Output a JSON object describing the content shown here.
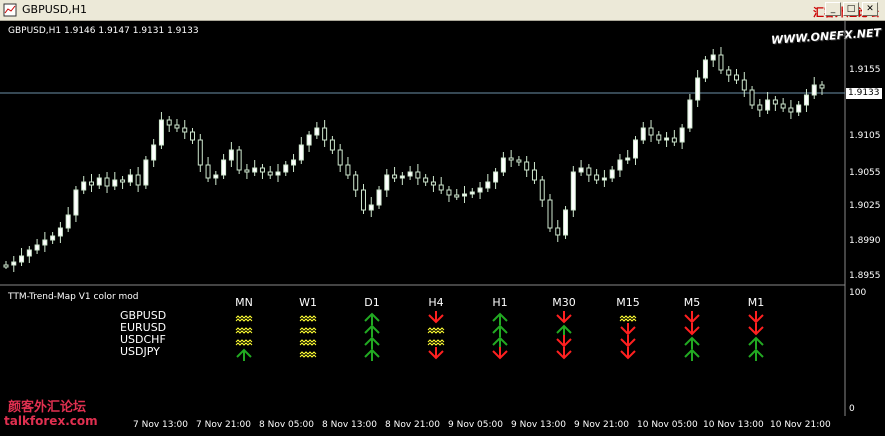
{
  "window": {
    "title": "GBPUSD,H1",
    "buttons": {
      "minimize": "_",
      "restore": "□",
      "close": "✕"
    }
  },
  "watermarks": {
    "top_cn": "汇客外汇论坛",
    "top_url": "WWW.ONEFX.NET",
    "bottom_cn": "颜客外汇论坛",
    "bottom_url": "talkforex.com"
  },
  "chart": {
    "symbol_header": "GBPUSD,H1  1.9146 1.9147 1.9131 1.9133",
    "current_price": "1.9133",
    "y_labels": [
      "1.9155",
      "1.9105",
      "1.9055",
      "1.9025",
      "1.8990",
      "1.8955"
    ],
    "x_labels": [
      "7 Nov 13:00",
      "7 Nov 21:00",
      "8 Nov 05:00",
      "8 Nov 13:00",
      "8 Nov 21:00",
      "9 Nov 05:00",
      "9 Nov 13:00",
      "9 Nov 21:00",
      "10 Nov 05:00",
      "10 Nov 13:00",
      "10 Nov 21:00"
    ]
  },
  "indicator": {
    "title": "TTM-Trend-Map V1 color mod",
    "axis_top": "100",
    "axis_bottom": "0",
    "timeframes": [
      "MN",
      "W1",
      "D1",
      "H4",
      "H1",
      "M30",
      "M15",
      "M5",
      "M1"
    ],
    "pairs": [
      "GBPUSD",
      "EURUSD",
      "USDCHF",
      "USDJPY"
    ],
    "signals": [
      [
        "flat",
        "flat",
        "flat",
        "up"
      ],
      [
        "flat",
        "flat",
        "flat",
        "flat"
      ],
      [
        "up",
        "up",
        "up",
        "up"
      ],
      [
        "down",
        "flat",
        "flat",
        "down"
      ],
      [
        "up",
        "up",
        "up",
        "down"
      ],
      [
        "down",
        "up",
        "down",
        "down"
      ],
      [
        "flat",
        "down",
        "down",
        "down"
      ],
      [
        "down",
        "down",
        "up",
        "up"
      ],
      [
        "down",
        "down",
        "up",
        "up"
      ]
    ],
    "colors": {
      "up": "#22aa22",
      "down": "#ff2020",
      "flat": "#ffff33"
    }
  }
}
